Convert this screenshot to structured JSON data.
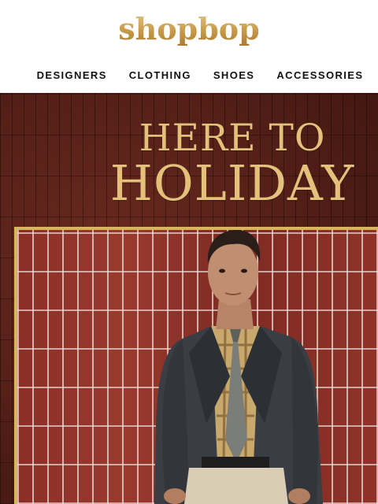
{
  "brand": {
    "logo_text": "shopbop",
    "accent_color": "#c89a4a"
  },
  "nav": {
    "items": [
      {
        "label": "DESIGNERS"
      },
      {
        "label": "CLOTHING"
      },
      {
        "label": "SHOES"
      },
      {
        "label": "ACCESSORIES"
      }
    ]
  },
  "hero": {
    "headline_line1": "HERE TO",
    "headline_line2": "HOLIDAY",
    "headline_color": "#e4c07a"
  }
}
